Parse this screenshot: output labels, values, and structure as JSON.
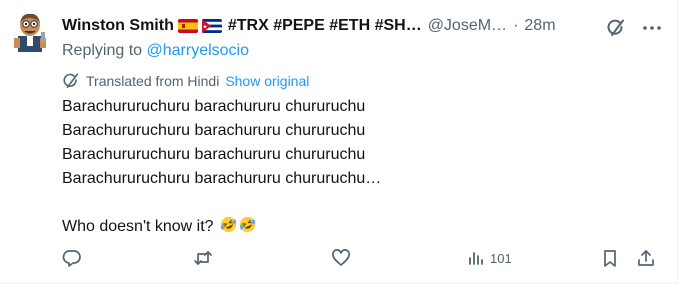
{
  "author": {
    "name": "Winston Smith",
    "hashtags": "#TRX #PEPE #ETH #SH…",
    "handle": "@JoseM…",
    "separator": "·",
    "time": "28m"
  },
  "replying": {
    "prefix": "Replying to ",
    "to": "@harryelsocio"
  },
  "translation": {
    "label": "Translated from Hindi",
    "show_original": "Show original"
  },
  "post": {
    "lines": [
      "Barachururuchuru barachururu chururuchu",
      "Barachururuchuru barachururu chururuchu",
      "Barachururuchuru barachururu chururuchu",
      "Barachururuchuru barachururu chururuchu…"
    ],
    "closing": "Who doesn't know it?"
  },
  "actions": {
    "views": "101"
  },
  "colors": {
    "accent": "#1d9bf0",
    "secondary_text": "#536471",
    "primary_text": "#0f1419"
  },
  "icons": [
    "grok-icon",
    "more-icon",
    "translate-icon",
    "reply-icon",
    "retweet-icon",
    "like-icon",
    "views-icon",
    "bookmark-icon",
    "share-icon"
  ]
}
